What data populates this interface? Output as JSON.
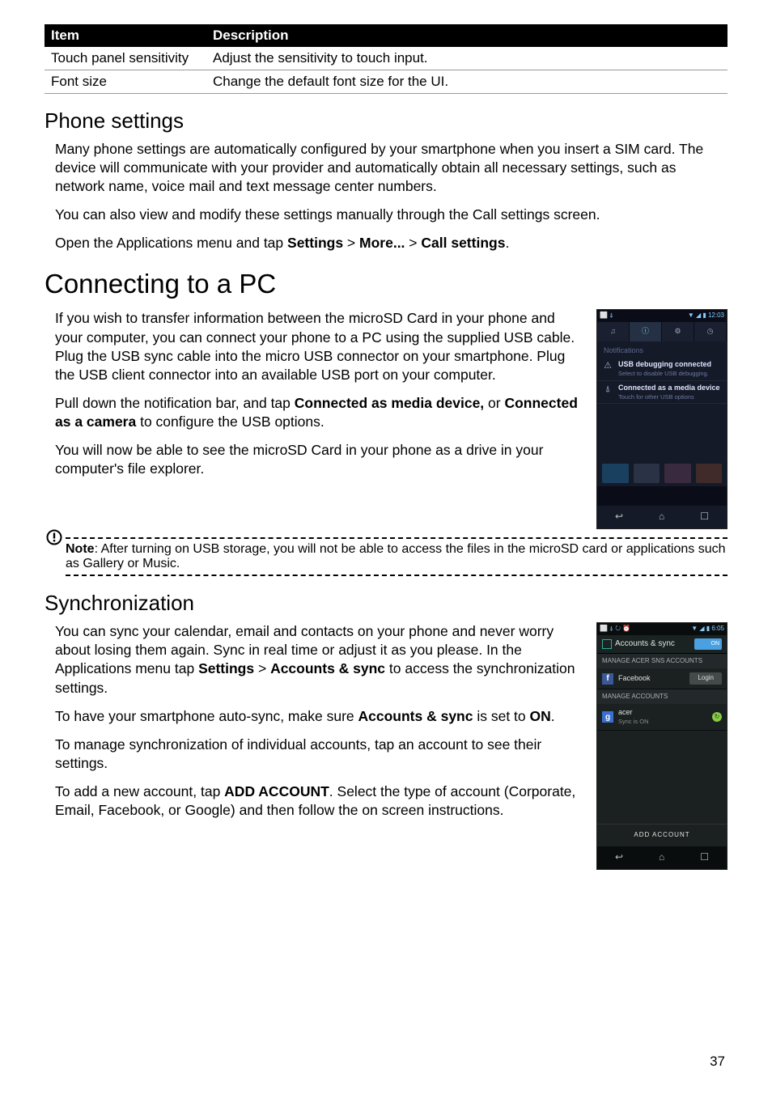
{
  "table": {
    "headers": {
      "item": "Item",
      "description": "Description"
    },
    "rows": [
      {
        "item": "Touch panel sensitivity",
        "description": "Adjust the sensitivity to touch input."
      },
      {
        "item": "Font size",
        "description": "Change the default font size for the UI."
      }
    ]
  },
  "phone_settings": {
    "heading": "Phone settings",
    "p1": "Many phone settings are automatically configured by your smartphone when you insert a SIM card. The device will communicate with your provider and automatically obtain all necessary settings, such as network name, voice mail and text message center numbers.",
    "p2": "You can also view and modify these settings manually through the Call settings screen.",
    "p3_pre": "Open the Applications menu and tap ",
    "p3_s1": "Settings",
    "p3_gt1": " > ",
    "p3_s2": "More...",
    "p3_gt2": " > ",
    "p3_s3": "Call settings",
    "p3_end": "."
  },
  "connecting": {
    "heading": "Connecting to a PC",
    "p1": "If you wish to transfer information between the microSD Card in your phone and your computer, you can connect your phone to a PC using the supplied USB cable. Plug the USB sync cable into the micro USB connector on your smartphone. Plug the USB client connector into an available USB port on your computer.",
    "p2_pre": "Pull down the notification bar, and tap ",
    "p2_b1": "Connected as media device,",
    "p2_mid": " or ",
    "p2_b2": "Connected as a camera",
    "p2_post": " to configure the USB options.",
    "p3": "You will now be able to see the microSD Card in your phone as a drive in your computer's file explorer.",
    "note_label": "Note",
    "note_body": ": After turning on USB storage, you will not be able to access the files in the microSD card or applications such as Gallery or Music."
  },
  "sync": {
    "heading": "Synchronization",
    "p1_pre": "You can sync your calendar, email and contacts on your phone and never worry about losing them again. Sync in real time or adjust it as you please. In the Applications menu tap ",
    "p1_b1": "Settings",
    "p1_mid": " > ",
    "p1_b2": "Accounts & sync",
    "p1_post": " to access the synchronization settings.",
    "p2_pre": "To have your smartphone auto-sync, make sure ",
    "p2_b1": "Accounts & sync",
    "p2_mid": " is set to ",
    "p2_b2": "ON",
    "p2_end": ".",
    "p3": "To manage synchronization of individual accounts, tap an account to see their settings.",
    "p4_pre": "To add a new account, tap ",
    "p4_b1": "ADD ACCOUNT",
    "p4_post": ". Select the type of account (Corporate, Email, Facebook, or Google) and then follow the on screen instructions."
  },
  "phone1": {
    "status_time": "12:03",
    "notifications_label": "Notifications",
    "item1_title": "USB debugging connected",
    "item1_sub": "Select to disable USB debugging.",
    "item2_title": "Connected as a media device",
    "item2_sub": "Touch for other USB options"
  },
  "phone2": {
    "status_time": "6:05",
    "title": "Accounts & sync",
    "switch_label": "ON",
    "section1": "MANAGE ACER SNS ACCOUNTS",
    "facebook": "Facebook",
    "login_btn": "Login",
    "section2": "MANAGE ACCOUNTS",
    "acct_name": "acer",
    "acct_sub": "Sync is ON",
    "add_account": "ADD ACCOUNT"
  },
  "page_number": "37"
}
